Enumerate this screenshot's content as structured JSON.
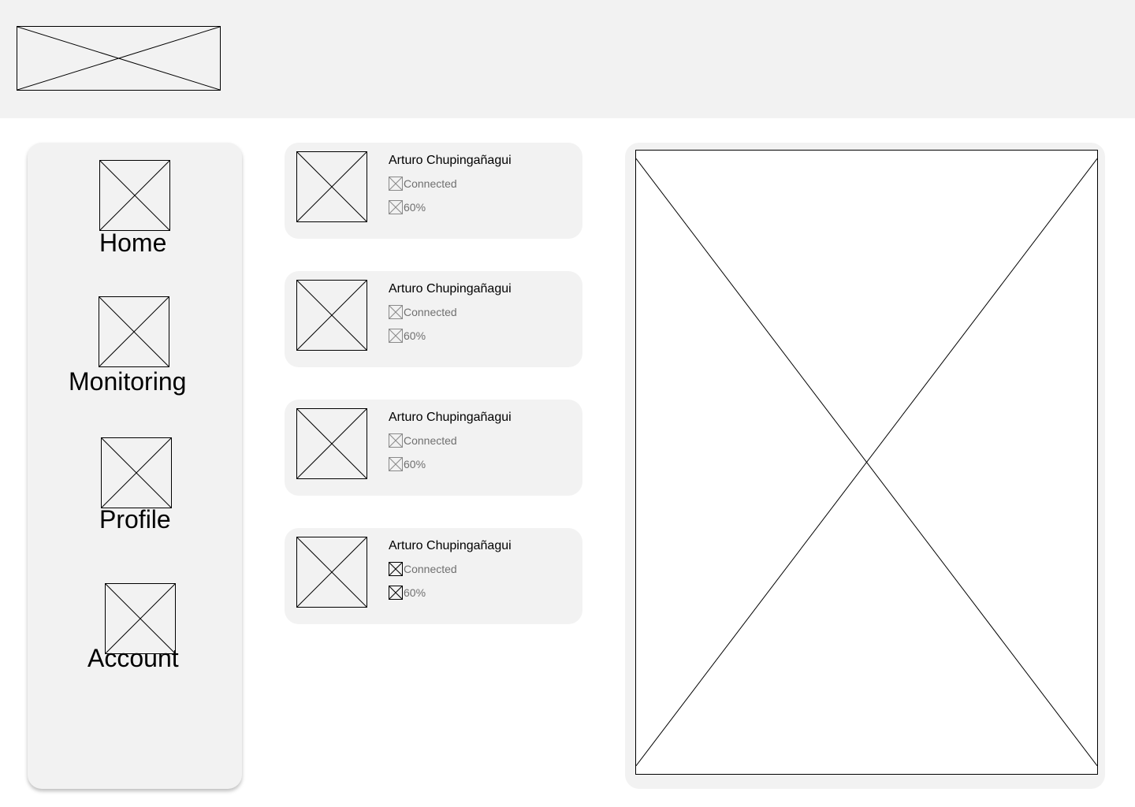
{
  "header": {
    "logo_icon": "image-placeholder-icon"
  },
  "sidebar": {
    "items": [
      {
        "label": "Home",
        "icon": "image-placeholder-icon"
      },
      {
        "label": "Monitoring",
        "icon": "image-placeholder-icon"
      },
      {
        "label": "Profile",
        "icon": "image-placeholder-icon"
      },
      {
        "label": "Account",
        "icon": "image-placeholder-icon"
      }
    ]
  },
  "cards": [
    {
      "name": "Arturo Chupingañagui",
      "status": "Connected",
      "battery": "60%"
    },
    {
      "name": "Arturo Chupingañagui",
      "status": "Connected",
      "battery": "60%"
    },
    {
      "name": "Arturo Chupingañagui",
      "status": "Connected",
      "battery": "60%"
    },
    {
      "name": "Arturo Chupingañagui",
      "status": "Connected",
      "battery": "60%"
    }
  ],
  "preview": {
    "icon": "image-placeholder-icon"
  },
  "colors": {
    "panel_bg": "#f2f2f2",
    "meta_text": "#707070",
    "border": "#000000"
  }
}
